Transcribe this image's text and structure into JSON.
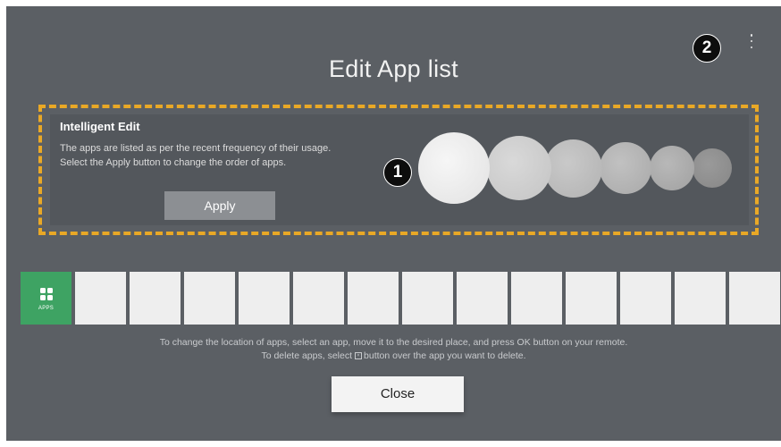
{
  "header": {
    "title": "Edit App list",
    "menu_icon": "vertical-ellipsis"
  },
  "callouts": {
    "one": "1",
    "two": "2"
  },
  "intelligent_edit": {
    "heading": "Intelligent Edit",
    "line1": "The apps are listed as per the recent frequency of their usage.",
    "line2": "Select the Apply button to change the order of apps.",
    "apply_label": "Apply",
    "highlight_color": "#e9a826"
  },
  "app_row": {
    "apps_label": "APPS",
    "apps_icon": "grid-icon",
    "apps_color": "#3ea363",
    "empty_slot_count": 13
  },
  "hints": {
    "line1": "To change the location of apps, select an app, move it to the desired place, and press OK button on your remote.",
    "line2_before": "To delete apps, select",
    "line2_after": "button over the app you want to delete."
  },
  "footer": {
    "close_label": "Close"
  }
}
